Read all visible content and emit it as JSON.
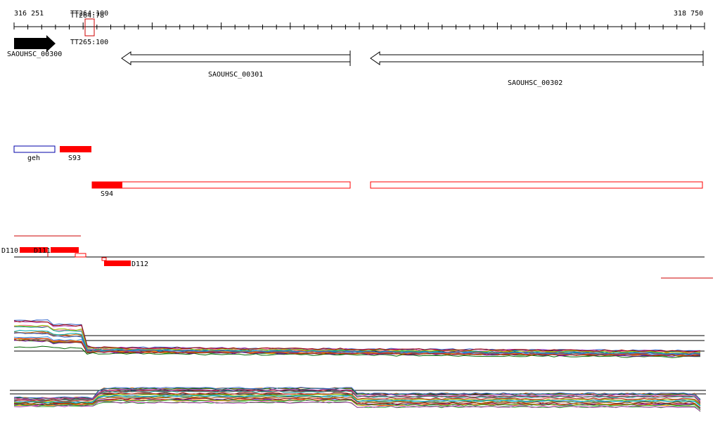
{
  "ruler": {
    "start_label": "316 251",
    "end_label": "318 750",
    "start": 316251,
    "end": 318750,
    "tick_count": 51
  },
  "terminators": [
    {
      "label": "TT264:100",
      "pos": "top"
    },
    {
      "label": "TT264:78",
      "pos": "top"
    },
    {
      "label": "TT265:100",
      "pos": "bottom"
    }
  ],
  "genes": [
    {
      "id": "g300",
      "label": "SAOUHSC_00300",
      "start": 316251,
      "end": 316400,
      "strand": "+",
      "fill": "#000000"
    },
    {
      "id": "g301",
      "label": "SAOUHSC_00301",
      "start": 316625,
      "end": 317440,
      "strand": "-",
      "fill": "#ffffff"
    },
    {
      "id": "g302",
      "label": "SAOUHSC_00302",
      "start": 317510,
      "end": 318750,
      "strand": "-",
      "fill": "#ffffff"
    }
  ],
  "features": [
    {
      "id": "f-geh",
      "label": "geh",
      "start": 316251,
      "end": 316400,
      "color": "#0000aa",
      "filled": false
    },
    {
      "id": "f-s93",
      "label": "S93",
      "start": 316418,
      "end": 316530,
      "color": "#ff0000",
      "filled": true
    },
    {
      "id": "f-s94",
      "label": "S94",
      "start": 316540,
      "end": 317440,
      "color": "#ff0000",
      "filled_end": 316650
    },
    {
      "id": "f-s94b",
      "label": "",
      "start": 317510,
      "end": 318750,
      "color": "#ff0000",
      "filled": false
    }
  ],
  "segments": [
    {
      "label": "D110"
    },
    {
      "label": "D111"
    },
    {
      "label": "D112"
    }
  ],
  "colors": {
    "accent": "#ff0000",
    "outline_blue": "#0000aa"
  }
}
